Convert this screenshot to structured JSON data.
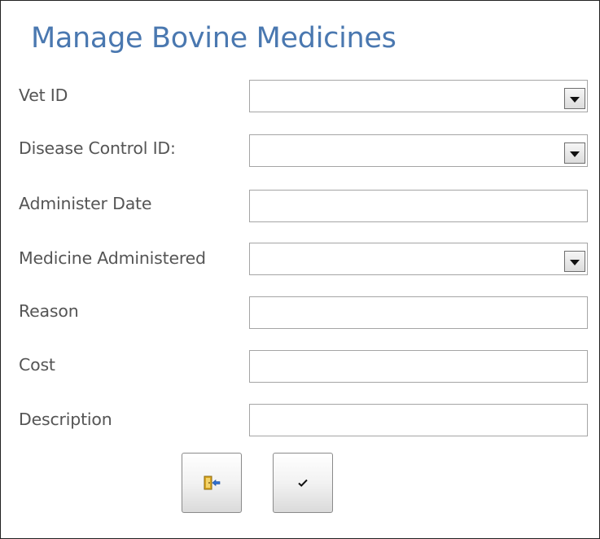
{
  "form": {
    "title": "Manage Bovine Medicines",
    "fields": [
      {
        "label": "Vet ID",
        "value": "",
        "type": "combo"
      },
      {
        "label": "Disease Control ID:",
        "value": "",
        "type": "combo"
      },
      {
        "label": "Administer Date",
        "value": "",
        "type": "text"
      },
      {
        "label": "Medicine Administered",
        "value": "",
        "type": "combo"
      },
      {
        "label": "Reason",
        "value": "",
        "type": "text"
      },
      {
        "label": "Cost",
        "value": "",
        "type": "text"
      },
      {
        "label": "Description",
        "value": "",
        "type": "text"
      }
    ],
    "buttons": [
      {
        "icon": "exit-door-icon"
      },
      {
        "icon": "checkmark-icon"
      }
    ]
  },
  "colors": {
    "title": "#4a78b0",
    "label": "#555555",
    "field_border": "#a5a5a5",
    "frame_border": "#222222"
  }
}
